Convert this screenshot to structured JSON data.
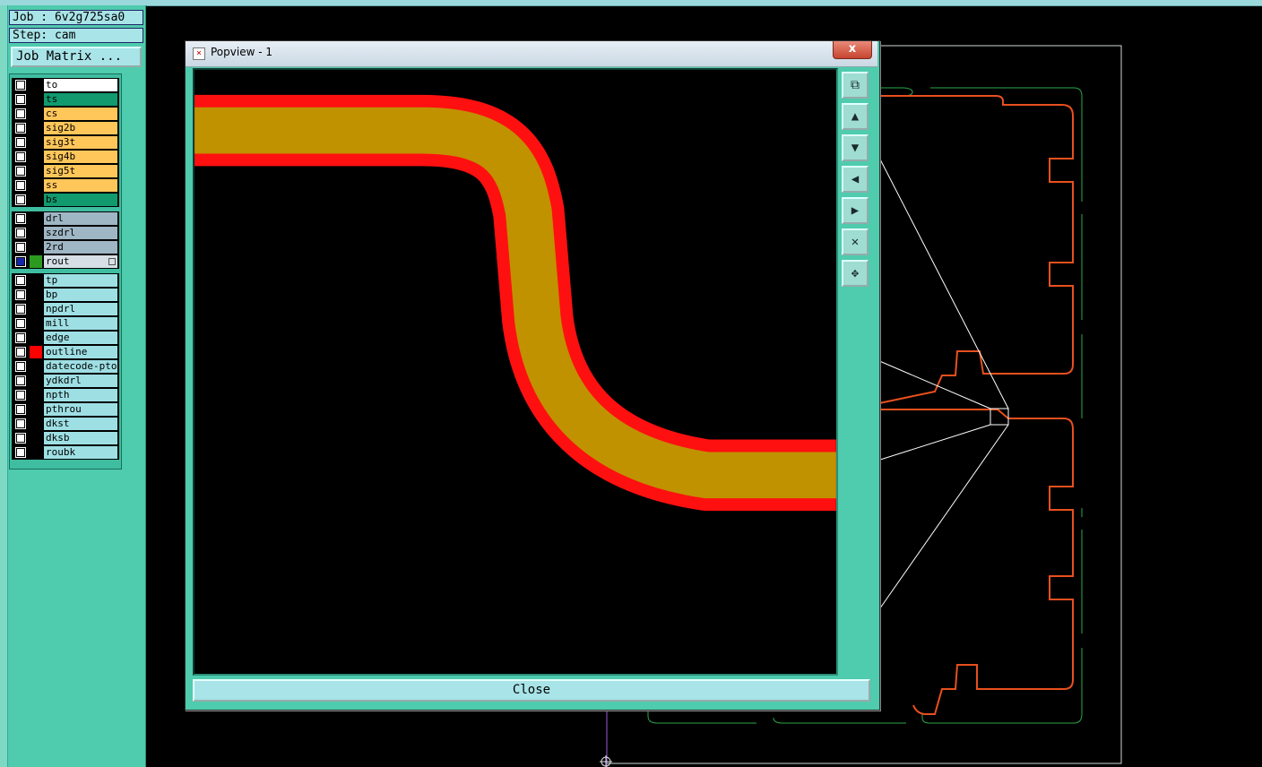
{
  "job": {
    "job_label": "Job : 6v2g725sa0",
    "step_label": "Step: cam"
  },
  "job_matrix_button": "Job Matrix ...",
  "layers": {
    "board": [
      {
        "name": "to",
        "color": "#ffffff",
        "swatch": "#000000",
        "selected": false
      },
      {
        "name": "ts",
        "color": "#109a6e",
        "swatch": "#000000",
        "selected": false
      },
      {
        "name": "cs",
        "color": "#ffc65a",
        "swatch": "#000000",
        "selected": false
      },
      {
        "name": "sig2b",
        "color": "#ffc65a",
        "swatch": "#000000",
        "selected": false
      },
      {
        "name": "sig3t",
        "color": "#ffc65a",
        "swatch": "#000000",
        "selected": false
      },
      {
        "name": "sig4b",
        "color": "#ffc65a",
        "swatch": "#000000",
        "selected": false
      },
      {
        "name": "sig5t",
        "color": "#ffc65a",
        "swatch": "#000000",
        "selected": false
      },
      {
        "name": "ss",
        "color": "#ffc65a",
        "swatch": "#000000",
        "selected": false
      },
      {
        "name": "bs",
        "color": "#109a6e",
        "swatch": "#000000",
        "selected": false
      }
    ],
    "drill": [
      {
        "name": "drl",
        "color": "#9fb6c4",
        "swatch": "#000000",
        "selected": false
      },
      {
        "name": "szdrl",
        "color": "#9fb6c4",
        "swatch": "#000000",
        "selected": false
      },
      {
        "name": "2rd",
        "color": "#9fb6c4",
        "swatch": "#000000",
        "selected": false
      },
      {
        "name": "rout",
        "color": "#d6dfe6",
        "swatch": "#2c9a1e",
        "selected": true
      }
    ],
    "misc": [
      {
        "name": "tp",
        "color": "#9edfe4",
        "swatch": "#000000",
        "selected": false
      },
      {
        "name": "bp",
        "color": "#9edfe4",
        "swatch": "#000000",
        "selected": false
      },
      {
        "name": "npdrl",
        "color": "#9edfe4",
        "swatch": "#000000",
        "selected": false
      },
      {
        "name": "mill",
        "color": "#9edfe4",
        "swatch": "#000000",
        "selected": false
      },
      {
        "name": "edge",
        "color": "#9edfe4",
        "swatch": "#000000",
        "selected": false
      },
      {
        "name": "outline",
        "color": "#9edfe4",
        "swatch": "#ff0000",
        "selected": false
      },
      {
        "name": "datecode-pto",
        "color": "#9edfe4",
        "swatch": "#000000",
        "selected": false
      },
      {
        "name": "ydkdrl",
        "color": "#9edfe4",
        "swatch": "#000000",
        "selected": false
      },
      {
        "name": "npth",
        "color": "#9edfe4",
        "swatch": "#000000",
        "selected": false
      },
      {
        "name": "pthrou",
        "color": "#9edfe4",
        "swatch": "#000000",
        "selected": false
      },
      {
        "name": "dkst",
        "color": "#9edfe4",
        "swatch": "#000000",
        "selected": false
      },
      {
        "name": "dksb",
        "color": "#9edfe4",
        "swatch": "#000000",
        "selected": false
      },
      {
        "name": "roubk",
        "color": "#9edfe4",
        "swatch": "#000000",
        "selected": false
      }
    ]
  },
  "popview": {
    "title": "Popview - 1",
    "close_x": "x",
    "close_button": "Close",
    "tools": [
      {
        "icon": "zoom-window-icon",
        "glyph": "⧉"
      },
      {
        "icon": "pan-up-icon",
        "glyph": "▲"
      },
      {
        "icon": "pan-down-icon",
        "glyph": "▼"
      },
      {
        "icon": "pan-left-icon",
        "glyph": "◀"
      },
      {
        "icon": "pan-right-icon",
        "glyph": "▶"
      },
      {
        "icon": "zoom-out-icon",
        "glyph": "✕"
      },
      {
        "icon": "zoom-fit-icon",
        "glyph": "✥"
      }
    ]
  },
  "colors": {
    "panel": "#4fcbad",
    "trace_fill": "#c09200",
    "trace_outline": "#ff1010",
    "rout_green": "#2ba84a",
    "outline_red": "#e8501e",
    "profile": "#cfd6d6"
  }
}
